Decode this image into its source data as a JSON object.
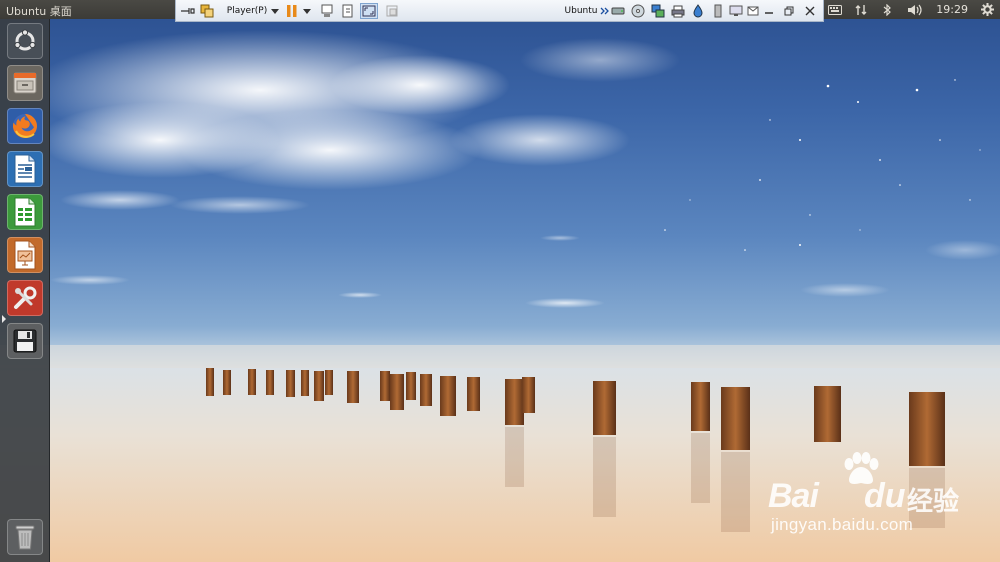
{
  "top_panel": {
    "title": "Ubuntu 桌面",
    "clock": "19:29",
    "tray_icons": [
      "keyboard-icon",
      "network-icon",
      "bluetooth-icon",
      "volume-icon",
      "gear-icon"
    ]
  },
  "vm_toolbar": {
    "player_menu_label": "Player(P)",
    "vm_name": "Ubuntu",
    "left_icons": [
      "unpin-icon",
      "vmware-logo-icon",
      "pause-icon",
      "dropdown-arrow-icon",
      "send-ctrl-alt-del-icon",
      "removable-device-icon",
      "fullscreen-icon",
      "unity-mode-icon"
    ],
    "right_icons": [
      "chevron-right-icon",
      "hard-disk-icon",
      "cd-dvd-icon",
      "network-adapter-icon",
      "printer-icon",
      "sound-card-icon",
      "usb-icon",
      "display-icon",
      "message-icon",
      "minimize-icon",
      "restore-icon",
      "close-icon"
    ]
  },
  "launcher": {
    "items": [
      {
        "name": "dash-home",
        "icon": "ubuntu-logo-icon"
      },
      {
        "name": "files",
        "icon": "file-cabinet-icon"
      },
      {
        "name": "firefox",
        "icon": "firefox-icon"
      },
      {
        "name": "libreoffice-writer",
        "icon": "writer-document-icon"
      },
      {
        "name": "libreoffice-calc",
        "icon": "calc-spreadsheet-icon"
      },
      {
        "name": "libreoffice-impress",
        "icon": "impress-presentation-icon"
      },
      {
        "name": "system-settings",
        "icon": "settings-tools-icon"
      },
      {
        "name": "save-disk",
        "icon": "floppy-disk-icon"
      }
    ],
    "trash_icon": "trash-icon"
  },
  "watermark": {
    "brand_latin_1": "Bai",
    "brand_latin_2": "du",
    "brand_cn": "经验",
    "url": "jingyan.baidu.com"
  }
}
